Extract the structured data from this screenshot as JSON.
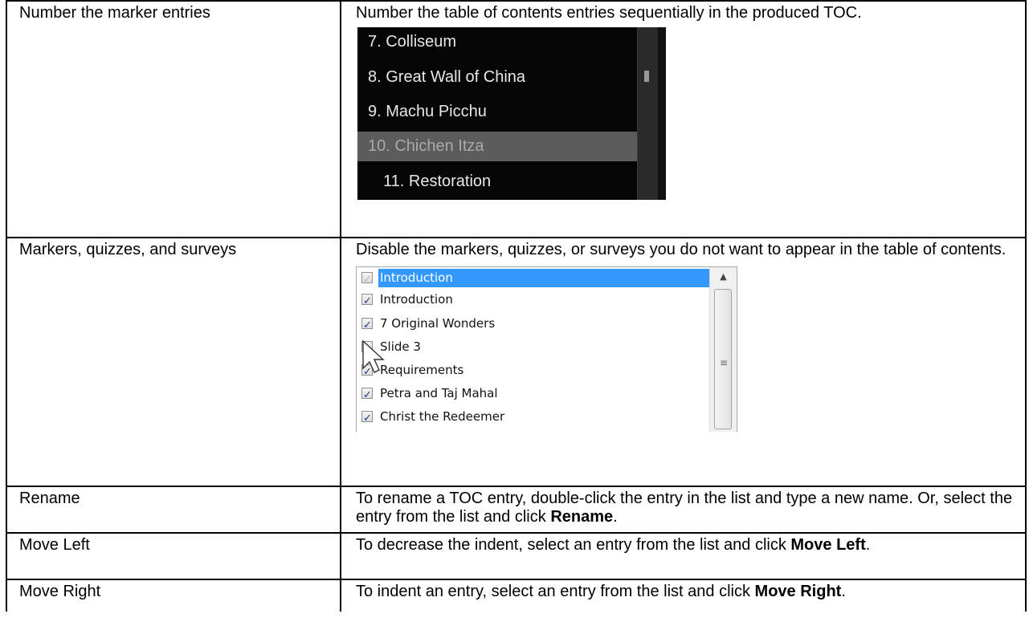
{
  "rows": [
    {
      "term": "Number the marker entries",
      "desc": "Number the table of contents entries sequentially in the produced TOC."
    },
    {
      "term": "Markers, quizzes, and surveys",
      "desc": "Disable the markers, quizzes, or surveys you do not want to appear in the table of contents."
    },
    {
      "term": "Rename",
      "desc_pre": "To rename a TOC entry, double-click the entry in the list and type a new name. Or, select the entry from the list and click ",
      "desc_bold": "Rename",
      "desc_post": "."
    },
    {
      "term": "Move Left",
      "desc_pre": "To decrease the indent, select an entry from the list and click ",
      "desc_bold": "Move Left",
      "desc_post": "."
    },
    {
      "term": "Move Right",
      "desc_pre": "To indent an entry, select an entry from the list and click ",
      "desc_bold": "Move Right",
      "desc_post": "."
    }
  ],
  "toc_panel": {
    "items": [
      "7. Colliseum",
      "8. Great Wall of China",
      "9. Machu Picchu",
      "10. Chichen Itza",
      "11. Restoration"
    ],
    "selected_index": 3
  },
  "list_panel": {
    "items": [
      {
        "label": "Introduction",
        "state": "dim",
        "selected": true
      },
      {
        "label": "Introduction",
        "state": "on"
      },
      {
        "label": "7 Original Wonders",
        "state": "on"
      },
      {
        "label": "Slide 3",
        "state": "off"
      },
      {
        "label": "Requirements",
        "state": "on"
      },
      {
        "label": "Petra and Taj Mahal",
        "state": "on"
      },
      {
        "label": "Christ the Redeemer",
        "state": "on"
      }
    ],
    "colors": {
      "selection": "#3399ff",
      "check": "#1f3a8a"
    }
  }
}
